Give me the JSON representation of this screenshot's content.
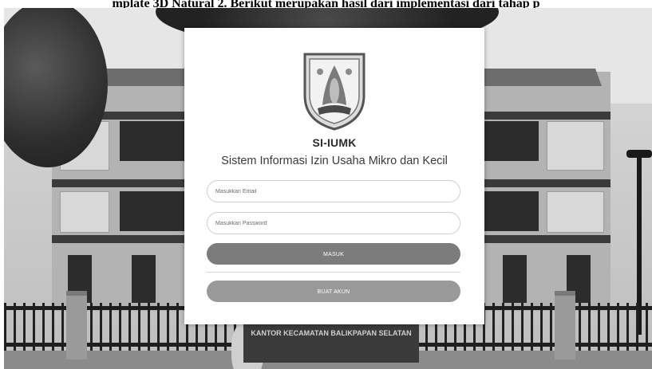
{
  "caption": "mplate 3D Natural 2. Berikut merupakan hasil dari implementasi dari tahap p",
  "app": {
    "name": "SI-IUMK",
    "subtitle": "Sistem Informasi Izin Usaha Mikro dan Kecil"
  },
  "form": {
    "email_placeholder": "Masukkan Email",
    "password_placeholder": "Masukkan Password",
    "login_label": "MASUK",
    "register_label": "BUAT AKUN"
  },
  "background": {
    "sign_text": "KANTOR KECAMATAN BALIKPAPAN SELATAN"
  },
  "colors": {
    "login_button": "#7c7c7c",
    "register_button": "#999999",
    "card": "#ffffff"
  },
  "icons": {
    "logo": "balikpapan-emblem"
  }
}
